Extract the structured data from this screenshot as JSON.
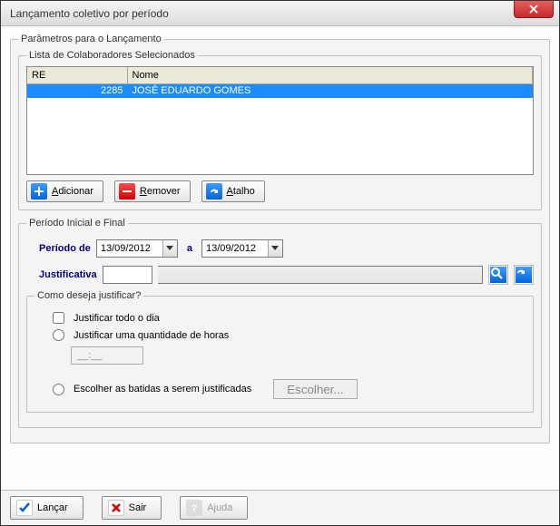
{
  "window": {
    "title": "Lançamento coletivo por período"
  },
  "params_legend": "Parâmetros para o Lançamento",
  "list_legend": "Lista de Colaboradores Selecionados",
  "table": {
    "headers": {
      "re": "RE",
      "nome": "Nome"
    },
    "rows": [
      {
        "re": "2285",
        "nome": "JOSÉ EDUARDO GOMES",
        "selected": true
      }
    ]
  },
  "buttons": {
    "add": {
      "accel": "A",
      "rest": "dicionar"
    },
    "remove": {
      "accel": "R",
      "rest": "emover"
    },
    "shortcut": {
      "accel": "A",
      "rest": "talho"
    },
    "launch": "Lançar",
    "exit": "Sair",
    "help": "Ajuda",
    "escolher": "Escolher..."
  },
  "period": {
    "legend": "Período Inicial e Final",
    "label_from": "Período de",
    "label_to": "a",
    "date_from": "13/09/2012",
    "date_to": "13/09/2012"
  },
  "justificativa": {
    "label": "Justificativa",
    "code": "",
    "desc": ""
  },
  "justify_group": {
    "legend": "Como deseja justificar?",
    "opt_all": "Justificar todo o dia",
    "opt_hours": "Justificar uma quantidade de horas",
    "hours_value": "__:__",
    "opt_pick": "Escolher as batidas a serem justificadas"
  }
}
